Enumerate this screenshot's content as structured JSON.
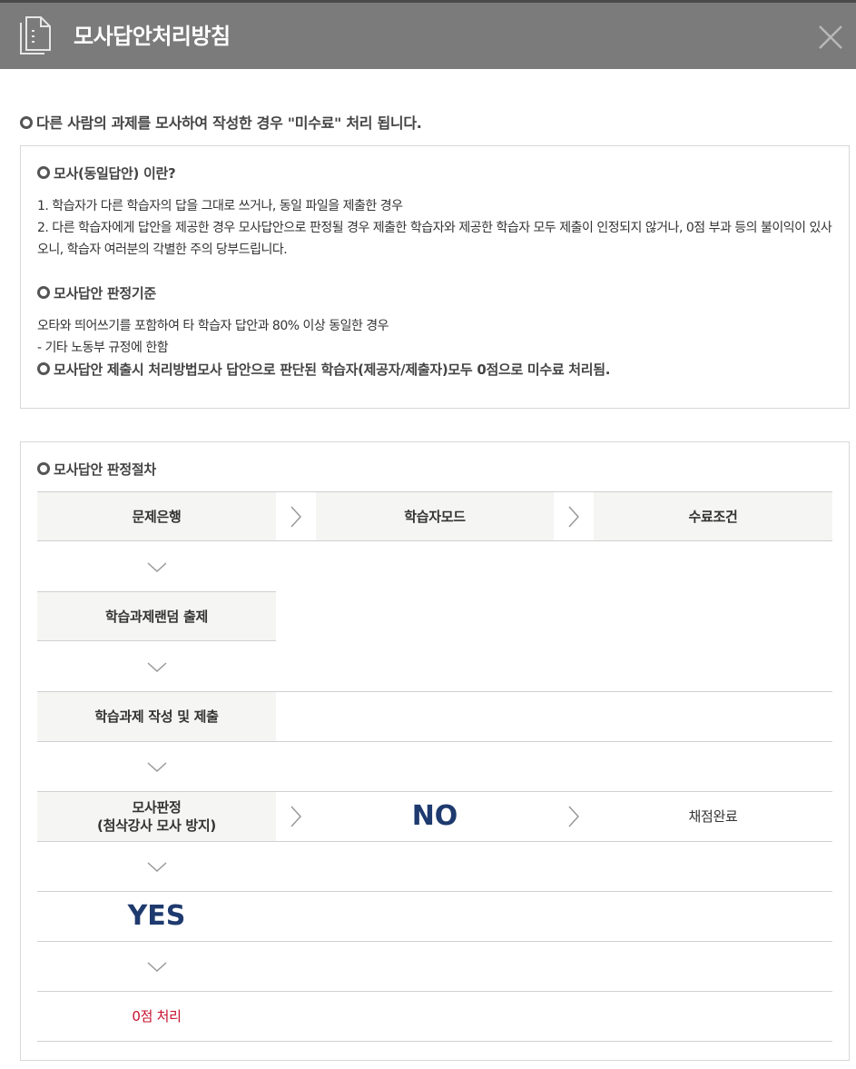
{
  "header": {
    "title": "모사답안처리방침",
    "doc_icon": "document-icon",
    "close_icon": "close-icon"
  },
  "notice": "다른 사람의 과제를 모사하여 작성한 경우 \"미수료\" 처리 됩니다.",
  "definition": {
    "title": "모사(동일답안) 이란?",
    "line1": "1. 학습자가 다른 학습자의 답을 그대로 쓰거나, 동일 파일을 제출한 경우",
    "line2": "2. 다른 학습자에게 답안을 제공한 경우 모사답안으로 판정될 경우 제출한 학습자와 제공한 학습자 모두 제출이 인정되지 않거나, 0점 부과 등의 불이익이 있사오니, 학습자 여러분의 각별한 주의 당부드립니다."
  },
  "criteria": {
    "title": "모사답안 판정기준",
    "line1": "오타와 띄어쓰기를 포함하여 타 학습자 답안과 80% 이상 동일한 경우",
    "line2": "- 기타 노동부 규정에 한함",
    "handling": "모사답안 제출시 처리방법모사 답안으로 판단된 학습자(제공자/제출자)모두 0점으로 미수료 처리됨."
  },
  "procedure": {
    "title": "모사답안 판정절차",
    "step_bank": "문제은행",
    "step_mode": "학습자모드",
    "step_condition": "수료조건",
    "step_random": "학습과제랜덤 출제",
    "step_submit": "학습과제 작성 및 제출",
    "step_judge_line1": "모사판정",
    "step_judge_line2": "(첨삭강사 모사 방지)",
    "no": "NO",
    "grading_done": "채점완료",
    "yes": "YES",
    "zero": "0점 처리"
  },
  "colors": {
    "header_bg": "#7b7b7b",
    "accent_navy": "#1e3a6e",
    "accent_red": "#c8102e"
  }
}
